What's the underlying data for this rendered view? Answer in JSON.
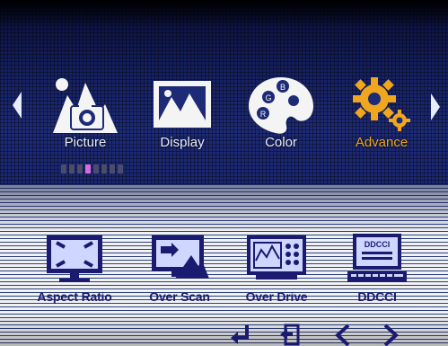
{
  "menu": {
    "tabs": [
      {
        "label": "Picture",
        "icon": "picture-icon"
      },
      {
        "label": "Display",
        "icon": "display-icon"
      },
      {
        "label": "Color",
        "icon": "color-palette-icon"
      },
      {
        "label": "Advance",
        "icon": "gear-icon"
      }
    ],
    "selected": "Advance",
    "page_indicator": {
      "count": 8,
      "active_index": 3
    }
  },
  "submenu": {
    "items": [
      {
        "label": "Aspect Ratio",
        "icon": "aspect-ratio-icon"
      },
      {
        "label": "Over Scan",
        "icon": "over-scan-icon"
      },
      {
        "label": "Over Drive",
        "icon": "over-drive-icon"
      },
      {
        "label": "DDCCI",
        "icon": "ddcci-icon"
      }
    ]
  },
  "ddcci_icon_text": "DDCCI",
  "controls": [
    {
      "name": "enter-icon"
    },
    {
      "name": "exit-icon"
    },
    {
      "name": "left-arrow-icon"
    },
    {
      "name": "right-arrow-icon"
    }
  ],
  "colors": {
    "accent_selected": "#f0a61f",
    "menu_text": "#e8ecff",
    "submenu_text": "#1a1a70",
    "top_background": "#1d2a75",
    "page_dot_active": "#d76bd8"
  }
}
